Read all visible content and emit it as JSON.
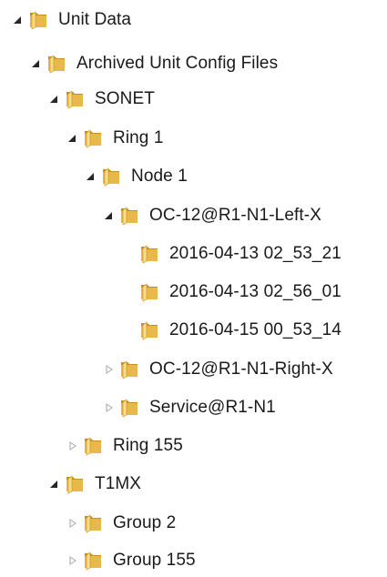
{
  "tree": {
    "nodes": [
      {
        "label": "Unit Data",
        "state": "expanded"
      },
      {
        "label": "Archived Unit Config Files",
        "state": "expanded"
      },
      {
        "label": "SONET",
        "state": "expanded"
      },
      {
        "label": "Ring 1",
        "state": "expanded"
      },
      {
        "label": "Node 1",
        "state": "expanded"
      },
      {
        "label": "OC-12@R1-N1-Left-X",
        "state": "expanded"
      },
      {
        "label": "2016-04-13 02_53_21",
        "state": "leaf"
      },
      {
        "label": "2016-04-13 02_56_01",
        "state": "leaf"
      },
      {
        "label": "2016-04-15 00_53_14",
        "state": "leaf"
      },
      {
        "label": "OC-12@R1-N1-Right-X",
        "state": "collapsed"
      },
      {
        "label": "Service@R1-N1",
        "state": "collapsed"
      },
      {
        "label": "Ring 155",
        "state": "collapsed"
      },
      {
        "label": "T1MX",
        "state": "expanded"
      },
      {
        "label": "Group 2",
        "state": "collapsed"
      },
      {
        "label": "Group 155",
        "state": "collapsed"
      }
    ]
  },
  "icons": {
    "expanded": "expanded-triangle-icon",
    "collapsed": "collapsed-triangle-icon",
    "folder": "folder-icon"
  },
  "colors": {
    "folder_body": "#e8b84a",
    "folder_light": "#f7dc8a",
    "folder_dark": "#c8901e",
    "expanded_arrow": "#262626",
    "collapsed_arrow": "#a6a6a6"
  }
}
